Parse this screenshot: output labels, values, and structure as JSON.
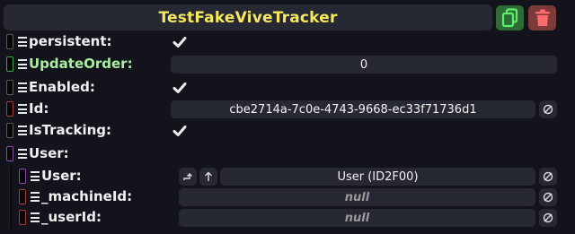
{
  "header": {
    "title": "TestFakeViveTracker",
    "duplicate_icon": "duplicate-icon",
    "delete_icon": "trash-icon",
    "duplicate_color": "#2f6b36",
    "delete_color": "#7d3a3a"
  },
  "fields": {
    "persistent": {
      "label": "persistent:",
      "checked": true
    },
    "update_order": {
      "label": "UpdateOrder:",
      "value": "0"
    },
    "enabled": {
      "label": "Enabled:",
      "checked": true
    },
    "id": {
      "label": "Id:",
      "value": "cbe2714a-7c0e-4743-9668-ec33f71736d1"
    },
    "is_tracking": {
      "label": "IsTracking:",
      "checked": true
    },
    "user_group": {
      "label": "User:"
    },
    "user": {
      "label": "User:",
      "value": "User  (ID2F00)"
    },
    "machine_id": {
      "label": "_machineId:",
      "value": "null"
    },
    "user_id": {
      "label": "_userId:",
      "value": "null"
    }
  },
  "colors": {
    "background": "#13141b",
    "field": "#262833",
    "title": "#f5e85c",
    "green_label": "#a9eea1"
  }
}
